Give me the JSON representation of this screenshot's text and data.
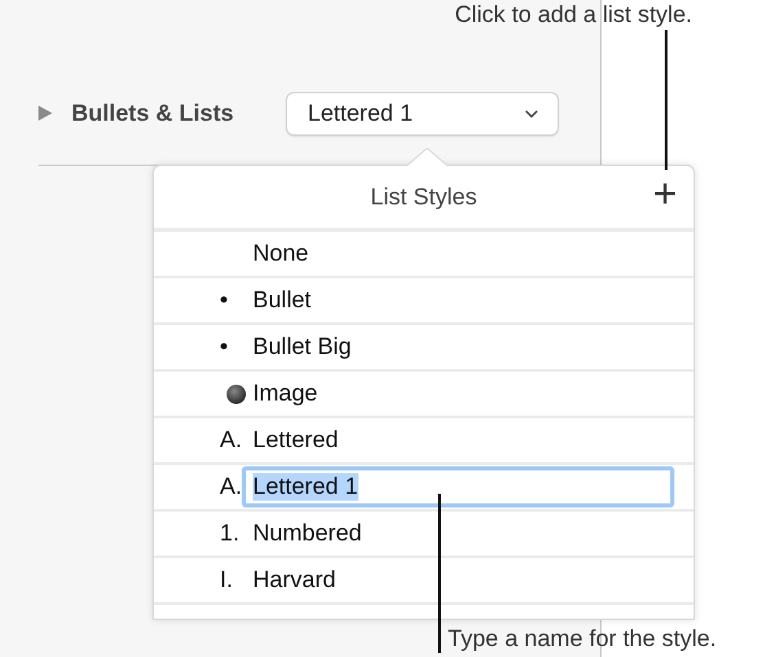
{
  "callouts": [
    {
      "kind": "top",
      "text": "Click to add a list style."
    },
    {
      "kind": "bottom",
      "text": "Type a name for the style."
    }
  ],
  "section": {
    "title": "Bullets & Lists",
    "expanded": false,
    "dropdown": {
      "value": "Lettered 1"
    }
  },
  "popover": {
    "title": "List Styles",
    "add_symbol": "+",
    "styles": [
      {
        "kind": "text",
        "name": "None",
        "editing": false
      },
      {
        "kind": "text",
        "marker": "•",
        "name": "Bullet",
        "editing": false
      },
      {
        "kind": "text",
        "marker": "•",
        "name": "Bullet Big",
        "editing": false
      },
      {
        "kind": "image",
        "name": "Image",
        "editing": false
      },
      {
        "kind": "text",
        "marker": "A.",
        "name": "Lettered",
        "editing": false
      },
      {
        "kind": "text",
        "marker": "A.",
        "name": "Lettered 1",
        "editing": true
      },
      {
        "kind": "text",
        "marker": "1.",
        "name": "Numbered",
        "editing": false
      },
      {
        "kind": "text",
        "marker": "I.",
        "name": "Harvard",
        "editing": false
      }
    ]
  }
}
